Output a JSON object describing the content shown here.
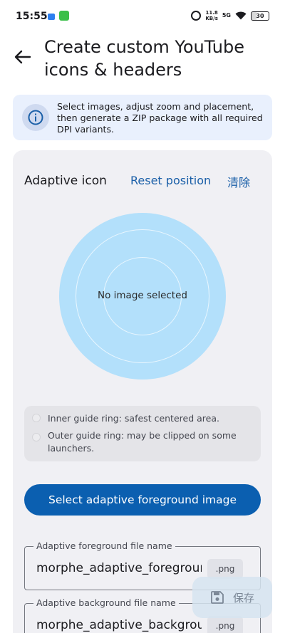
{
  "status_bar": {
    "time": "15:55",
    "net_speed_value": "11.8",
    "net_speed_unit": "KB/s",
    "network": "5G",
    "battery": "30"
  },
  "header": {
    "title": "Create custom YouTube icons & headers"
  },
  "info_banner": {
    "text": "Select images, adjust zoom and placement, then generate a ZIP package with all required DPI variants."
  },
  "icon_card": {
    "title": "Adaptive icon",
    "reset_label": "Reset position",
    "clear_label": "清除",
    "preview_placeholder": "No image selected",
    "legend": {
      "inner": "Inner guide ring: safest centered area.",
      "outer": "Outer guide ring: may be clipped on some launchers."
    },
    "select_button": "Select adaptive foreground image",
    "fields": [
      {
        "label": "Adaptive foreground file name",
        "value": "morphe_adaptive_foreground",
        "suffix": ".png"
      },
      {
        "label": "Adaptive background file name",
        "value": "morphe_adaptive_background",
        "suffix": ".png"
      }
    ]
  },
  "save_fab": {
    "label": "保存"
  },
  "colors": {
    "accent": "#0b5fb0",
    "link": "#1a5fa8",
    "preview_fill": "#b3e0fb",
    "banner_bg": "#e9f0fd"
  },
  "icons": {
    "back": "arrow-left-icon",
    "info": "info-icon",
    "save": "floppy-disk-icon"
  }
}
